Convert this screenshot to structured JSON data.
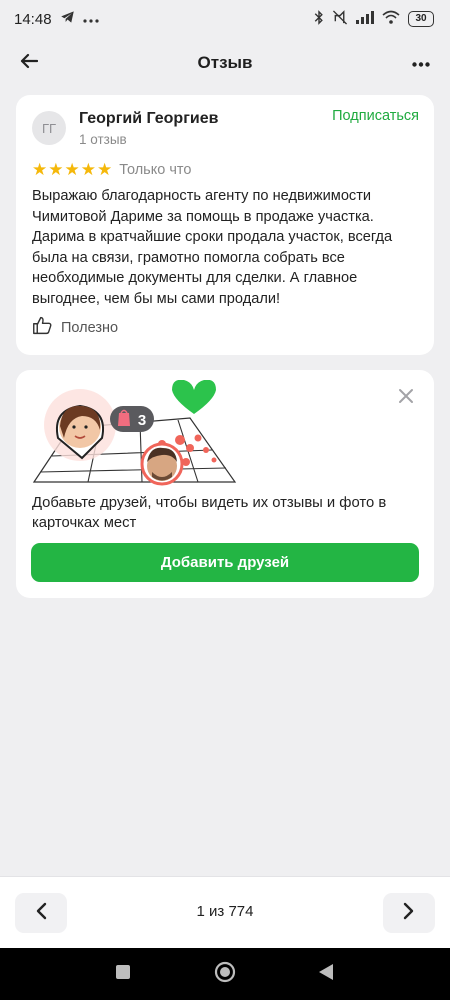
{
  "status_bar": {
    "time": "14:48",
    "battery": "30",
    "icons": [
      "telegram-icon",
      "more-dots-icon",
      "bluetooth-icon",
      "mute-icon",
      "signal-icon",
      "wifi-icon",
      "battery-icon"
    ]
  },
  "header": {
    "title": "Отзыв",
    "back_icon": "arrow-left-icon",
    "more_icon": "more-horizontal-icon"
  },
  "review": {
    "author_initials": "ГГ",
    "author_name": "Георгий Георгиев",
    "author_reviews": "1 отзыв",
    "subscribe_label": "Подписаться",
    "rating": 5,
    "rating_max": 5,
    "time": "Только что",
    "text": "Выражаю благодарность агенту по недвижимости Чимитовой Дариме за помощь в продаже участка. Дарима в кратчайшие сроки продала участок, всегда была на связи, грамотно помогла собрать все необходимые документы для сделки. А главное выгоднее, чем бы мы сами продали!",
    "useful_label": "Полезно"
  },
  "promo": {
    "badge_count": "3",
    "text": "Добавьте друзей, чтобы видеть их отзывы и фото в карточках мест",
    "button_label": "Добавить друзей"
  },
  "pager": {
    "label": "1 из 774"
  },
  "colors": {
    "accent_green": "#23b544",
    "subscribe_green": "#1faa3f",
    "star_yellow": "#f5b80a",
    "background": "#efeff1"
  }
}
